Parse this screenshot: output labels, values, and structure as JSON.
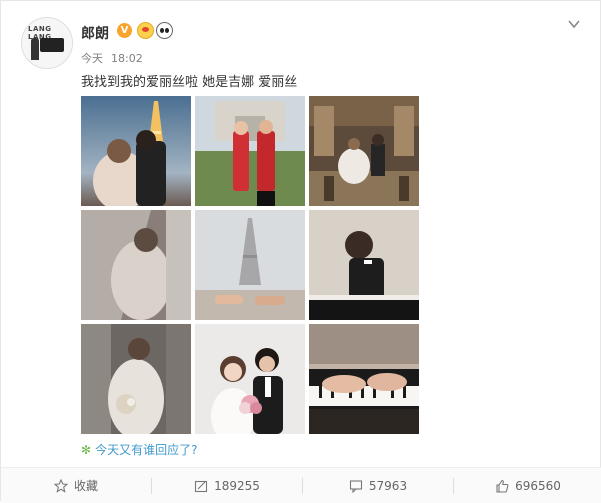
{
  "post": {
    "author": "郎朗",
    "verified_label": "V",
    "time_day": "今天",
    "time_clock": "18:02",
    "text": "我找到我的爱丽丝啦 她是吉娜 爱丽丝",
    "prompt": "今天又有谁回应了?"
  },
  "avatar": {
    "text": "LANG LANG"
  },
  "photos": [
    {
      "name": "photo-eiffel-night"
    },
    {
      "name": "photo-couple-red-outfits"
    },
    {
      "name": "photo-paris-cafe"
    },
    {
      "name": "photo-bride-veil"
    },
    {
      "name": "photo-eiffel-hands"
    },
    {
      "name": "photo-piano-player"
    },
    {
      "name": "photo-bride-bouquet"
    },
    {
      "name": "photo-couple-portrait"
    },
    {
      "name": "photo-hands-on-piano"
    }
  ],
  "actions": {
    "favorite_label": "收藏",
    "repost_count": "189255",
    "comment_count": "57963",
    "like_count": "696560"
  },
  "colors": {
    "link": "#409acd",
    "badge": "#f7a42a"
  }
}
